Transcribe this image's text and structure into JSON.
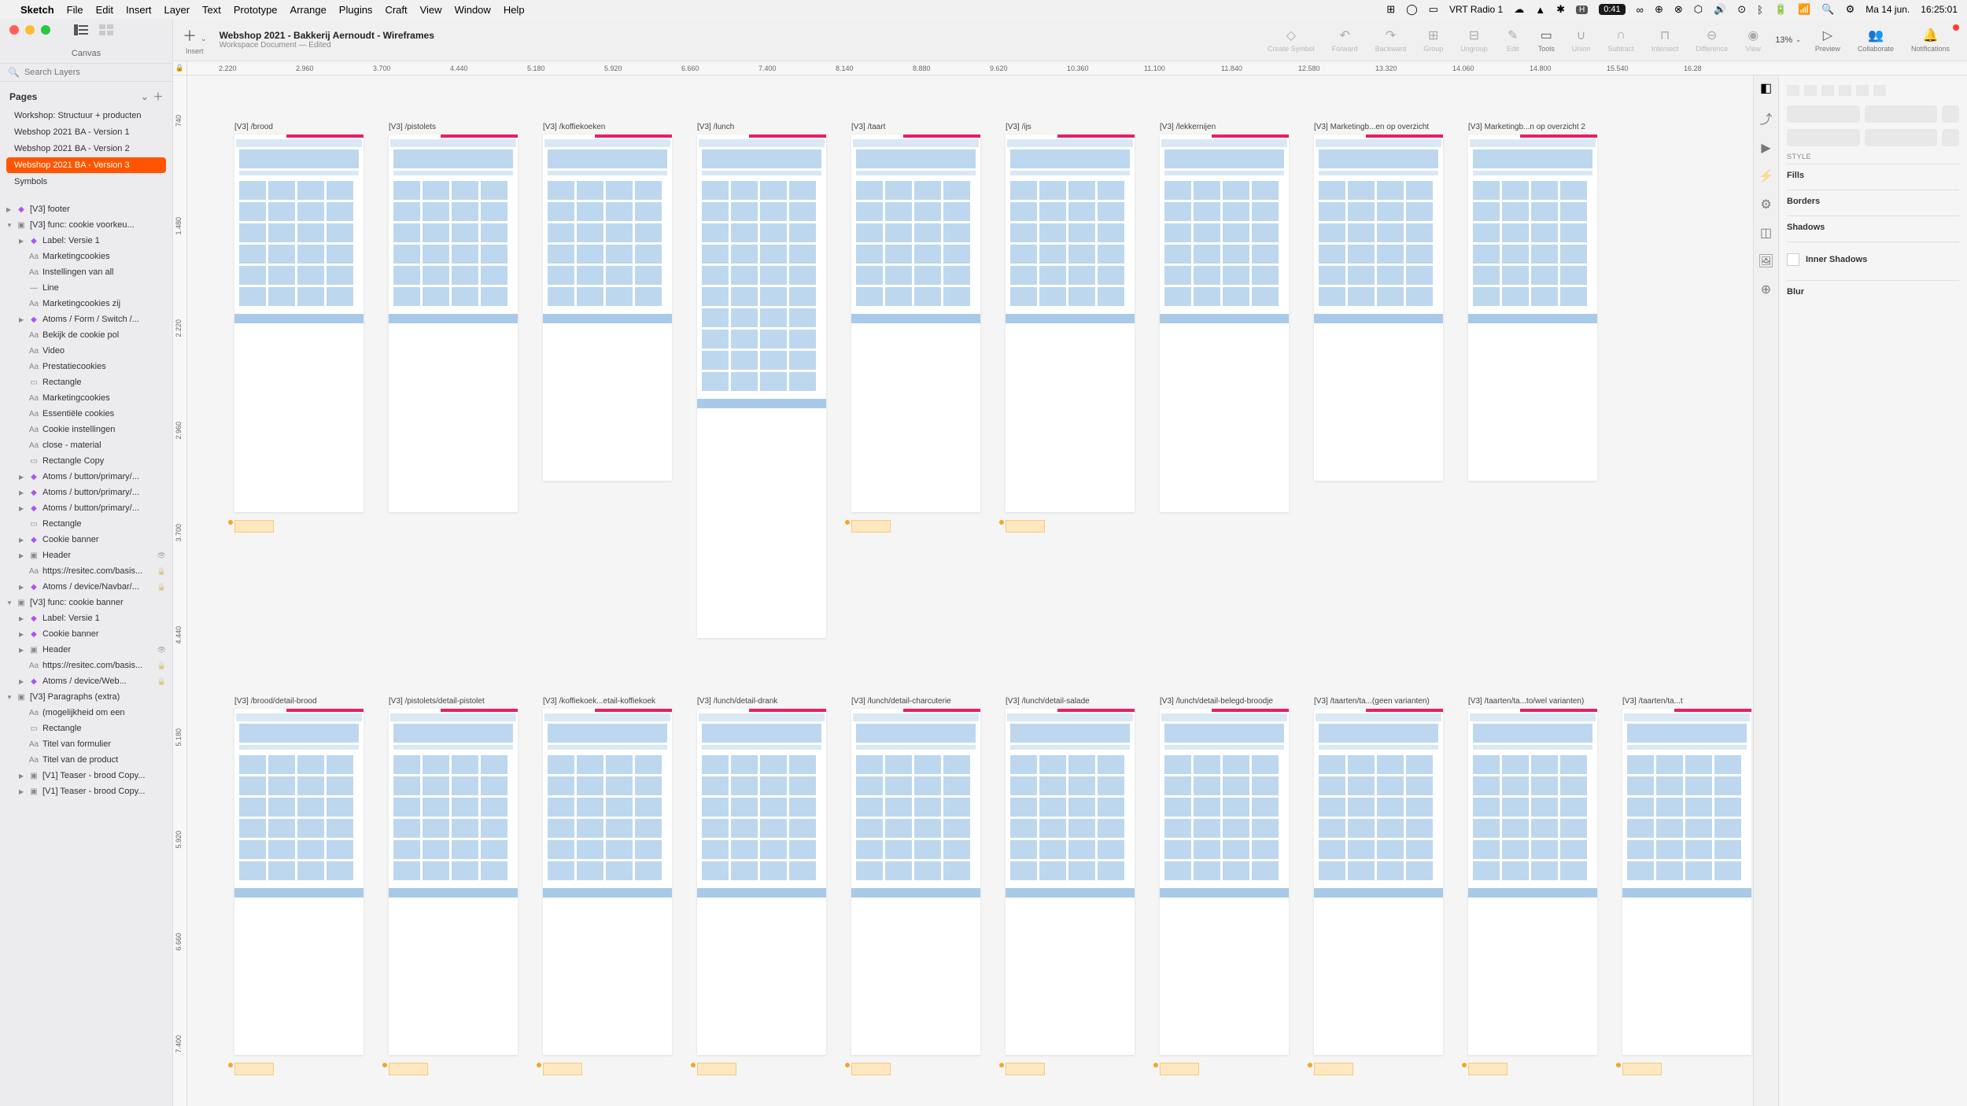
{
  "menubar": {
    "app": "Sketch",
    "items": [
      "File",
      "Edit",
      "Insert",
      "Layer",
      "Text",
      "Prototype",
      "Arrange",
      "Plugins",
      "Craft",
      "View",
      "Window",
      "Help"
    ],
    "radio": "VRT Radio 1",
    "time_badge": "0:41",
    "date": "Ma 14 jun.",
    "time": "16:25:01"
  },
  "sidebar": {
    "canvas_label": "Canvas",
    "search_placeholder": "Search Layers",
    "pages_header": "Pages",
    "pages": [
      {
        "name": "Workshop: Structuur + producten",
        "selected": false
      },
      {
        "name": "Webshop 2021 BA - Version 1",
        "selected": false
      },
      {
        "name": "Webshop 2021 BA - Version 2",
        "selected": false
      },
      {
        "name": "Webshop 2021 BA - Version 3",
        "selected": true
      },
      {
        "name": "Symbols",
        "selected": false
      }
    ],
    "layers": [
      {
        "type": "group",
        "icon": "diamond",
        "name": "[V3] footer",
        "indent": 0,
        "disc": true
      },
      {
        "type": "group",
        "icon": "folder",
        "name": "[V3] func: cookie voorkeu...",
        "indent": 0,
        "disc": true,
        "open": true
      },
      {
        "type": "item",
        "icon": "diamond",
        "name": "Label: Versie 1",
        "indent": 1,
        "disc": true
      },
      {
        "type": "item",
        "icon": "text",
        "name": "Marketingcookies",
        "indent": 1
      },
      {
        "type": "item",
        "icon": "text",
        "name": "Instellingen van all",
        "indent": 1
      },
      {
        "type": "item",
        "icon": "line",
        "name": "Line",
        "indent": 1
      },
      {
        "type": "item",
        "icon": "text",
        "name": "Marketingcookies zij",
        "indent": 1
      },
      {
        "type": "item",
        "icon": "diamond",
        "name": "Atoms / Form / Switch /...",
        "indent": 1,
        "disc": true
      },
      {
        "type": "item",
        "icon": "text",
        "name": "Bekijk de cookie pol",
        "indent": 1
      },
      {
        "type": "item",
        "icon": "text",
        "name": "Video",
        "indent": 1
      },
      {
        "type": "item",
        "icon": "text",
        "name": "Prestatiecookies",
        "indent": 1
      },
      {
        "type": "item",
        "icon": "rect",
        "name": "Rectangle",
        "indent": 1
      },
      {
        "type": "item",
        "icon": "text",
        "name": "Marketingcookies",
        "indent": 1
      },
      {
        "type": "item",
        "icon": "text",
        "name": "Essentiële cookies",
        "indent": 1
      },
      {
        "type": "item",
        "icon": "text",
        "name": "Cookie instellingen",
        "indent": 1
      },
      {
        "type": "item",
        "icon": "text",
        "name": "close - material",
        "indent": 1
      },
      {
        "type": "item",
        "icon": "rect",
        "name": "Rectangle Copy",
        "indent": 1
      },
      {
        "type": "item",
        "icon": "diamond",
        "name": "Atoms / button/primary/...",
        "indent": 1,
        "disc": true
      },
      {
        "type": "item",
        "icon": "diamond",
        "name": "Atoms / button/primary/...",
        "indent": 1,
        "disc": true
      },
      {
        "type": "item",
        "icon": "diamond",
        "name": "Atoms / button/primary/...",
        "indent": 1,
        "disc": true
      },
      {
        "type": "item",
        "icon": "rect",
        "name": "Rectangle",
        "indent": 1
      },
      {
        "type": "item",
        "icon": "diamond",
        "name": "Cookie banner",
        "indent": 1,
        "disc": true
      },
      {
        "type": "item",
        "icon": "folder",
        "name": "Header",
        "indent": 1,
        "disc": true,
        "hidden": true
      },
      {
        "type": "item",
        "icon": "text",
        "name": "https://resitec.com/basis...",
        "indent": 1,
        "lock": true
      },
      {
        "type": "item",
        "icon": "diamond",
        "name": "Atoms / device/Navbar/...",
        "indent": 1,
        "disc": true,
        "lock": true
      },
      {
        "type": "group",
        "icon": "folder",
        "name": "[V3] func: cookie banner",
        "indent": 0,
        "disc": true,
        "open": true
      },
      {
        "type": "item",
        "icon": "diamond",
        "name": "Label: Versie 1",
        "indent": 1,
        "disc": true
      },
      {
        "type": "item",
        "icon": "diamond",
        "name": "Cookie banner",
        "indent": 1,
        "disc": true
      },
      {
        "type": "item",
        "icon": "folder",
        "name": "Header",
        "indent": 1,
        "disc": true,
        "hidden": true
      },
      {
        "type": "item",
        "icon": "text",
        "name": "https://resitec.com/basis...",
        "indent": 1,
        "lock": true
      },
      {
        "type": "item",
        "icon": "diamond",
        "name": "Atoms / device/Web...",
        "indent": 1,
        "disc": true,
        "lock": true
      },
      {
        "type": "group",
        "icon": "folder",
        "name": "[V3] Paragraphs (extra)",
        "indent": 0,
        "disc": true,
        "open": true
      },
      {
        "type": "item",
        "icon": "text",
        "name": "(mogelijkheid om een",
        "indent": 1
      },
      {
        "type": "item",
        "icon": "rect",
        "name": "Rectangle",
        "indent": 1
      },
      {
        "type": "item",
        "icon": "text",
        "name": "Titel van formulier",
        "indent": 1
      },
      {
        "type": "item",
        "icon": "text",
        "name": "Titel van de product",
        "indent": 1
      },
      {
        "type": "item",
        "icon": "folder",
        "name": "[V1] Teaser - brood Copy...",
        "indent": 1,
        "disc": true
      },
      {
        "type": "item",
        "icon": "folder",
        "name": "[V1] Teaser - brood Copy...",
        "indent": 1,
        "disc": true
      }
    ]
  },
  "toolbar": {
    "insert": "Insert",
    "doc_title": "Webshop 2021 - Bakkerij Aernoudt - Wireframes",
    "doc_subtitle": "Workspace Document — Edited",
    "buttons": [
      {
        "icon": "◇",
        "label": "Create Symbol"
      },
      {
        "icon": "↶",
        "label": "Forward"
      },
      {
        "icon": "↷",
        "label": "Backward"
      },
      {
        "icon": "⊞",
        "label": "Group"
      },
      {
        "icon": "⊟",
        "label": "Ungroup"
      },
      {
        "icon": "✎",
        "label": "Edit"
      },
      {
        "icon": "▭",
        "label": "Tools",
        "active": true
      },
      {
        "icon": "∪",
        "label": "Union"
      },
      {
        "icon": "∩",
        "label": "Subtract"
      },
      {
        "icon": "⊓",
        "label": "Intersect"
      },
      {
        "icon": "⊖",
        "label": "Difference"
      },
      {
        "icon": "◉",
        "label": "View"
      }
    ],
    "zoom": "13%",
    "right_buttons": [
      {
        "icon": "▷",
        "label": "Preview"
      },
      {
        "icon": "👥",
        "label": "Collaborate"
      },
      {
        "icon": "🔔",
        "label": "Notifications",
        "badge": true
      }
    ]
  },
  "ruler_h": [
    "2.220",
    "2.960",
    "3.700",
    "4.440",
    "5.180",
    "5.920",
    "6.660",
    "7.400",
    "8.140",
    "8.880",
    "9.620",
    "10.360",
    "11.100",
    "11.840",
    "12.580",
    "13.320",
    "14.060",
    "14.800",
    "15.540",
    "16.28"
  ],
  "ruler_v": [
    "740",
    "1.480",
    "2.220",
    "2.960",
    "3.700",
    "4.440",
    "5.180",
    "5.920",
    "6.660",
    "7.400"
  ],
  "artboards_row1": [
    {
      "title": "[V3] /brood"
    },
    {
      "title": "[V3] /pistolets"
    },
    {
      "title": "[V3] /koffiekoeken"
    },
    {
      "title": "[V3] /lunch"
    },
    {
      "title": "[V3] /taart"
    },
    {
      "title": "[V3] /ijs"
    },
    {
      "title": "[V3] /lekkernijen"
    },
    {
      "title": "[V3] Marketingb...en op overzicht"
    },
    {
      "title": "[V3] Marketingb...n op overzicht 2"
    }
  ],
  "artboards_row2": [
    {
      "title": "[V3] /brood/detail-brood"
    },
    {
      "title": "[V3] /pistolets/detail-pistolet"
    },
    {
      "title": "[V3] /koffiekoek...etail-koffiekoek"
    },
    {
      "title": "[V3] /lunch/detail-drank"
    },
    {
      "title": "[V3] /lunch/detail-charcuterie"
    },
    {
      "title": "[V3] /lunch/detail-salade"
    },
    {
      "title": "[V3] /lunch/detail-belegd-broodje"
    },
    {
      "title": "[V3] /taarten/ta...(geen varianten)"
    },
    {
      "title": "[V3] /taarten/ta...to/wel varianten)"
    },
    {
      "title": "[V3] /taarten/ta...t"
    }
  ],
  "inspector": {
    "style_label": "STYLE",
    "sections": [
      "Fills",
      "Borders",
      "Shadows",
      "Inner Shadows",
      "Blur"
    ]
  }
}
